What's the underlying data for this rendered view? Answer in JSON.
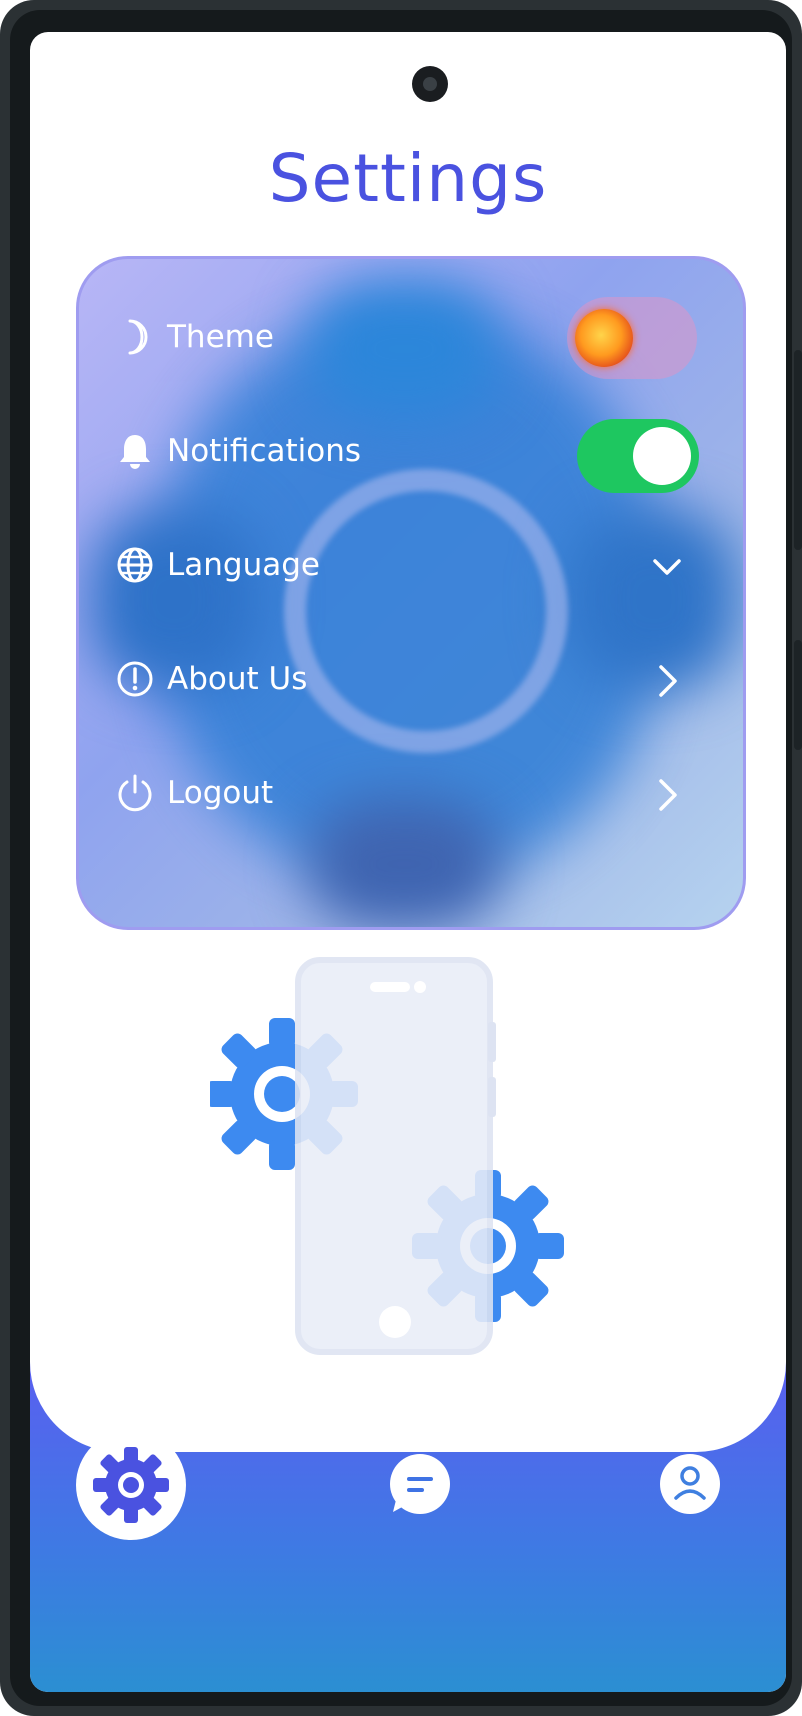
{
  "header": {
    "title": "Settings"
  },
  "settings": {
    "items": [
      {
        "label": "Theme",
        "icon": "moon-icon",
        "control": "theme-toggle"
      },
      {
        "label": "Notifications",
        "icon": "bell-icon",
        "control": "toggle-on"
      },
      {
        "label": "Language",
        "icon": "globe-icon",
        "control": "chevron-down-icon"
      },
      {
        "label": "About Us",
        "icon": "info-circle-icon",
        "control": "chevron-right-icon"
      },
      {
        "label": "Logout",
        "icon": "power-icon",
        "control": "chevron-right-icon"
      }
    ],
    "notifications_enabled": true
  },
  "bottom_nav": {
    "items": [
      {
        "name": "settings",
        "icon": "gear-icon",
        "active": true
      },
      {
        "name": "chat",
        "icon": "chat-bubble-icon",
        "active": false
      },
      {
        "name": "profile",
        "icon": "user-icon",
        "active": false
      }
    ]
  },
  "colors": {
    "accent": "#4a52e0",
    "toggle_on": "#1ec760",
    "nav_gradient_top": "#5a5ff0",
    "nav_gradient_bottom": "#2b8fd2"
  }
}
